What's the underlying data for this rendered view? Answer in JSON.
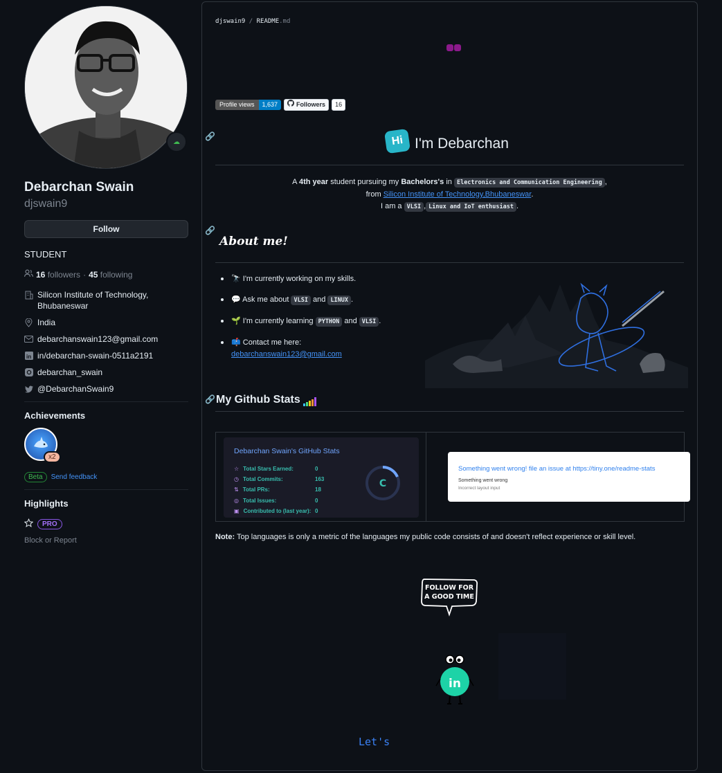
{
  "profile": {
    "fullname": "Debarchan Swain",
    "login": "djswain9",
    "follow_label": "Follow",
    "bio": "STUDENT",
    "followers_count": "16",
    "followers_word": "followers",
    "dot": "·",
    "following_count": "45",
    "following_word": "following",
    "org": "Silicon Institute of Technology, Bhubaneswar",
    "location": "India",
    "email": "debarchanswain123@gmail.com",
    "linkedin": "in/debarchan-swain-0511a2191",
    "instagram": "debarchan_swain",
    "twitter": "@DebarchanSwain9"
  },
  "achievements": {
    "title": "Achievements",
    "badge_count": "x2",
    "beta_label": "Beta",
    "feedback_label": "Send feedback"
  },
  "highlights": {
    "title": "Highlights",
    "pro_label": "PRO",
    "block_label": "Block or Report"
  },
  "readme": {
    "crumb_user": "djswain9",
    "crumb_sep": "/",
    "crumb_file": "README",
    "crumb_ext": ".md",
    "profile_views_label": "Profile views",
    "profile_views_value": "1,637",
    "followers_badge_label": "Followers",
    "followers_badge_value": "16",
    "hi_glyph": "Hi",
    "heading": "I'm Debarchan",
    "intro": {
      "a": "A ",
      "year": "4th year",
      "mid": " student pursuing my ",
      "degree": "Bachelors's",
      "in": " in ",
      "branch": "Electronics and Communication Engineering",
      "comma": ",",
      "from": "from ",
      "college": "Silicon Institute of Technology,Bhubaneswar",
      "dot": ".",
      "iam": "I am a ",
      "vlsi": "VLSI",
      "comma2": ",",
      "linux": "Linux and IoT enthusiast",
      "dot2": "."
    },
    "about_title": "About me!",
    "about": {
      "item1": "I'm currently working on my skills.",
      "item2_a": "Ask me about ",
      "item2_code1": "VLSI",
      "item2_and": " and ",
      "item2_code2": "LINUX",
      "item2_end": ".",
      "item3_a": "I'm currently learning ",
      "item3_code1": "PYTHON",
      "item3_and": " and ",
      "item3_code2": "VLSI",
      "item3_end": ".",
      "item4_a": "Contact me here:",
      "item4_email": "debarchanswain123@gmail.com"
    },
    "stats_title": "My Github Stats",
    "stats_card": {
      "title": "Debarchan Swain's GitHub Stats",
      "rows": [
        {
          "label": "Total Stars Earned:",
          "value": "0"
        },
        {
          "label": "Total Commits:",
          "value": "163"
        },
        {
          "label": "Total PRs:",
          "value": "18"
        },
        {
          "label": "Total Issues:",
          "value": "0"
        },
        {
          "label": "Contributed to (last year):",
          "value": "0"
        }
      ],
      "grade": "C"
    },
    "error_card": {
      "title": "Something went wrong! file an issue at https://tiny.one/readme-stats",
      "line1": "Something went wrong",
      "line2": "Incorrect layout input"
    },
    "note_label": "Note:",
    "note_text": " Top languages is only a metric of the languages my public code consists of and doesn't reflect experience or skill level.",
    "bubble_line1": "FOLLOW FOR",
    "bubble_line2": "A GOOD TIME",
    "linkedin_mascot": "in",
    "lets": "Let's"
  }
}
